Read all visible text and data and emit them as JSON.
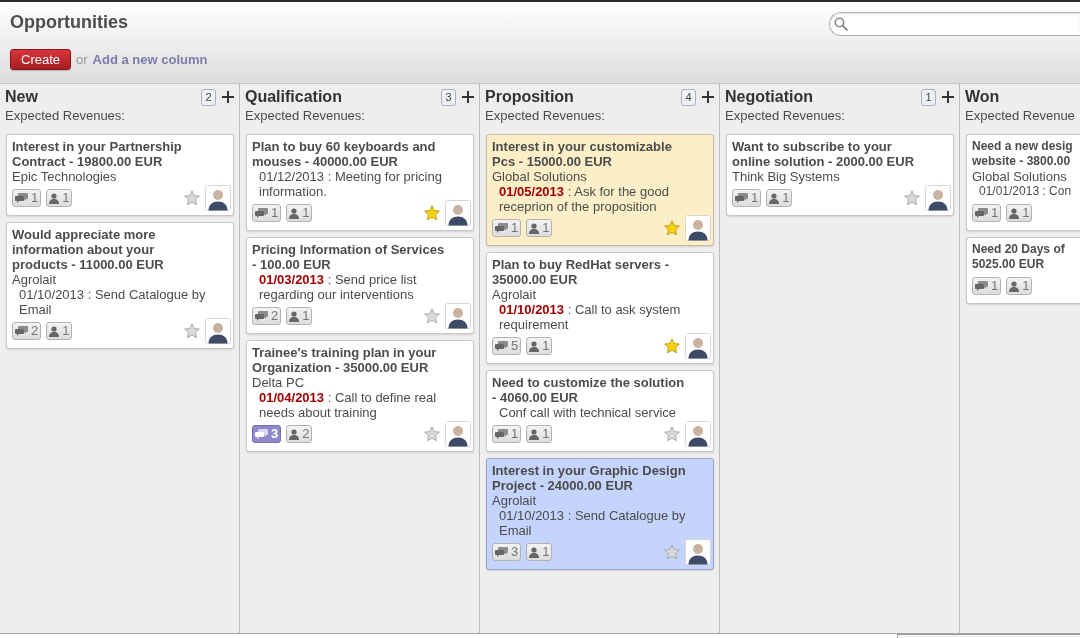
{
  "header": {
    "title": "Opportunities",
    "create_button": "Create",
    "or_text": "or",
    "add_column_link": "Add a new column"
  },
  "columns": [
    {
      "title": "New",
      "count": "2",
      "revenue_label": "Expected Revenues:",
      "cards": [
        {
          "title": "Interest in your Partnership Contract - 19800.00 EUR",
          "company": "Epic Technologies",
          "messages": "1",
          "followers": "1",
          "unread": false,
          "starred": false,
          "color": "#ffffff"
        },
        {
          "title": "Would appreciate more information about your products - 11000.00 EUR",
          "company": "Agrolait",
          "activity": {
            "date": "01/10/2013",
            "text": ": Send Catalogue by Email",
            "overdue": false
          },
          "messages": "2",
          "followers": "1",
          "unread": false,
          "starred": false,
          "color": "#ffffff"
        }
      ]
    },
    {
      "title": "Qualification",
      "count": "3",
      "revenue_label": "Expected Revenues:",
      "cards": [
        {
          "title": "Plan to buy 60 keyboards and mouses - 40000.00 EUR",
          "activity": {
            "date": "01/12/2013",
            "text": ": Meeting for pricing information.",
            "overdue": false
          },
          "messages": "1",
          "followers": "1",
          "unread": false,
          "starred": true,
          "color": "#ffffff"
        },
        {
          "title": "Pricing Information of Services - 100.00 EUR",
          "activity": {
            "date": "01/03/2013",
            "text": ": Send price list regarding our interventions",
            "overdue": true
          },
          "messages": "2",
          "followers": "1",
          "unread": false,
          "starred": false,
          "color": "#ffffff"
        },
        {
          "title": "Trainee's training plan in your Organization - 35000.00 EUR",
          "company": "Delta PC",
          "activity": {
            "date": "01/04/2013",
            "text": ": Call to define real needs about training",
            "overdue": true
          },
          "messages": "3",
          "followers": "2",
          "unread": true,
          "starred": false,
          "color": "#ffffff"
        }
      ]
    },
    {
      "title": "Proposition",
      "count": "4",
      "revenue_label": "Expected Revenues:",
      "cards": [
        {
          "title": "Interest in your customizable Pcs - 15000.00 EUR",
          "company": "Global Solutions",
          "activity": {
            "date": "01/05/2013",
            "text": ": Ask for the good receprion of the proposition",
            "overdue": true
          },
          "messages": "1",
          "followers": "1",
          "unread": false,
          "starred": true,
          "color": "#fcefc7"
        },
        {
          "title": "Plan to buy RedHat servers - 35000.00 EUR",
          "company": "Agrolait",
          "activity": {
            "date": "01/10/2013",
            "text": ": Call to ask system requirement",
            "overdue": true
          },
          "messages": "5",
          "followers": "1",
          "unread": false,
          "starred": true,
          "color": "#ffffff"
        },
        {
          "title": "Need to customize the solution - 4060.00 EUR",
          "activity": {
            "text": "Conf call with technical service"
          },
          "messages": "1",
          "followers": "1",
          "unread": false,
          "starred": false,
          "color": "#ffffff"
        },
        {
          "title": "Interest in your Graphic Design Project - 24000.00 EUR",
          "company": "Agrolait",
          "activity": {
            "date": "01/10/2013",
            "text": ": Send Catalogue by Email",
            "overdue": false
          },
          "messages": "3",
          "followers": "1",
          "unread": false,
          "starred": false,
          "color": "#c5d4fc"
        }
      ]
    },
    {
      "title": "Negotiation",
      "count": "1",
      "revenue_label": "Expected Revenues:",
      "cards": [
        {
          "title": "Want to subscribe to your online solution - 2000.00 EUR",
          "company": "Think Big Systems",
          "messages": "1",
          "followers": "1",
          "unread": false,
          "starred": false,
          "color": "#ffffff"
        }
      ]
    },
    {
      "title": "Won",
      "revenue_label": "Expected Revenue",
      "cards": [
        {
          "title": "Need a new desig website - 3800.00",
          "company": "Global Solutions",
          "activity": {
            "date": "01/01/2013",
            "text": ": Con",
            "overdue": false
          },
          "messages": "1",
          "followers": "1",
          "unread": false,
          "color": "#ffffff"
        },
        {
          "title": "Need 20 Days of 5025.00 EUR",
          "messages": "1",
          "followers": "1",
          "unread": false,
          "color": "#ffffff"
        }
      ]
    }
  ]
}
